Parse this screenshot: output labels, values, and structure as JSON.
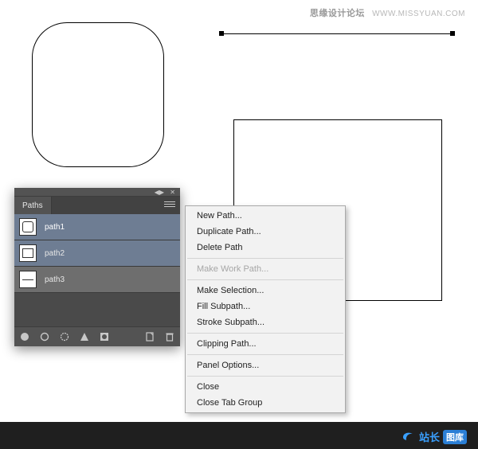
{
  "watermark": {
    "cn": "思缘设计论坛",
    "url": "WWW.MISSYUAN.COM"
  },
  "panel": {
    "tab": "Paths",
    "paths": [
      {
        "name": "path1"
      },
      {
        "name": "path2"
      },
      {
        "name": "path3"
      }
    ]
  },
  "context_menu": {
    "groups": [
      [
        {
          "label": "New Path...",
          "enabled": true
        },
        {
          "label": "Duplicate Path...",
          "enabled": true
        },
        {
          "label": "Delete Path",
          "enabled": true
        }
      ],
      [
        {
          "label": "Make Work Path...",
          "enabled": false
        }
      ],
      [
        {
          "label": "Make Selection...",
          "enabled": true
        },
        {
          "label": "Fill Subpath...",
          "enabled": true
        },
        {
          "label": "Stroke Subpath...",
          "enabled": true
        }
      ],
      [
        {
          "label": "Clipping Path...",
          "enabled": true
        }
      ],
      [
        {
          "label": "Panel Options...",
          "enabled": true
        }
      ],
      [
        {
          "label": "Close",
          "enabled": true
        },
        {
          "label": "Close Tab Group",
          "enabled": true
        }
      ]
    ]
  },
  "footer_logo": {
    "prefix": "站长",
    "badge": "图库"
  }
}
